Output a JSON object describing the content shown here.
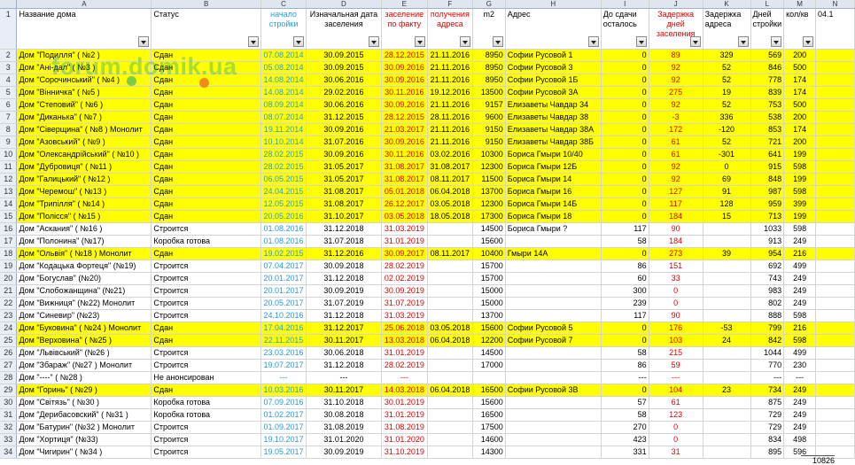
{
  "columns": [
    "A",
    "B",
    "C",
    "D",
    "E",
    "F",
    "G",
    "H",
    "I",
    "J",
    "K",
    "L",
    "M",
    "N"
  ],
  "headers": {
    "name": "Название дома",
    "status": "Статус",
    "start": "начало стройки",
    "orig_date": "Изначальная дата заселения",
    "actual": "заселение по факту",
    "address_received": "получения адреса",
    "m2": "m2",
    "address": "Адрес",
    "left_days": "До сдачи осталось",
    "delay_days": "Задержка дней заселения",
    "address_delay": "Задержка адреса",
    "build_days": "Дней стройки",
    "apartments": "кол/кв",
    "extra": "04.1"
  },
  "rows": [
    {
      "r": "2",
      "hl": true,
      "name": "Дом \"Подилля\" ( №2 )",
      "status": "Сдан",
      "start": "07.08.2014",
      "orig": "30.09.2015",
      "actual": "28.12.2015",
      "addr_date": "21.11.2016",
      "m2": "8950",
      "address": "Софии Русовой 1",
      "left": "0",
      "delay": "89",
      "adelay": "329",
      "days": "569",
      "apts": "200"
    },
    {
      "r": "3",
      "hl": true,
      "name": "Дом \"Ані-дал\" ( №3 )",
      "status": "Сдан",
      "start": "05.08.2014",
      "orig": "30.09.2015",
      "actual": "30.09.2016",
      "addr_date": "21.11.2016",
      "m2": "8950",
      "address": "Софии Русовой 3",
      "left": "0",
      "delay": "92",
      "adelay": "52",
      "days": "846",
      "apts": "500"
    },
    {
      "r": "4",
      "hl": true,
      "name": "Дом \"Сорочинський\" ( №4 )",
      "status": "Сдан",
      "start": "14.08.2014",
      "orig": "30.06.2016",
      "actual": "30.09.2016",
      "addr_date": "21.11.2016",
      "m2": "8950",
      "address": "Софии Русовой 1Б",
      "left": "0",
      "delay": "92",
      "adelay": "52",
      "days": "778",
      "apts": "174"
    },
    {
      "r": "5",
      "hl": true,
      "name": "Дом \"Вінничка\" ( №5 )",
      "status": "Сдан",
      "start": "14.08.2014",
      "orig": "29.02.2016",
      "actual": "30.11.2016",
      "addr_date": "19.12.2016",
      "m2": "13500",
      "address": "Софии Русовой 3А",
      "left": "0",
      "delay": "275",
      "adelay": "19",
      "days": "839",
      "apts": "174"
    },
    {
      "r": "6",
      "hl": true,
      "name": "Дом \"Степовий\" ( №6 )",
      "status": "Сдан",
      "start": "08.09.2014",
      "orig": "30.06.2016",
      "actual": "30.09.2016",
      "addr_date": "21.11.2016",
      "m2": "9157",
      "address": "Елизаветы Чавдар 34",
      "left": "0",
      "delay": "92",
      "adelay": "52",
      "days": "753",
      "apts": "500"
    },
    {
      "r": "7",
      "hl": true,
      "name": "Дом \"Диканька\" ( №7 )",
      "status": "Сдан",
      "start": "08.07.2014",
      "orig": "31.12.2015",
      "actual": "28.12.2015",
      "addr_date": "28.11.2016",
      "m2": "9600",
      "address": "Елизаветы Чавдар 38",
      "left": "0",
      "delay": "-3",
      "adelay": "336",
      "days": "538",
      "apts": "200"
    },
    {
      "r": "8",
      "hl": true,
      "name": "Дом \"Сіверщина\" ( №8 ) Монолит",
      "status": "Сдан",
      "start": "19.11.2014",
      "orig": "30.09.2016",
      "actual": "21.03.2017",
      "addr_date": "21.11.2016",
      "m2": "9150",
      "address": "Елизаветы Чавдар 38А",
      "left": "0",
      "delay": "172",
      "adelay": "-120",
      "days": "853",
      "apts": "174"
    },
    {
      "r": "9",
      "hl": true,
      "name": "Дом \"Азовський\" ( №9 )",
      "status": "Сдан",
      "start": "10.10.2014",
      "orig": "31.07.2016",
      "actual": "30.09.2016",
      "addr_date": "21.11.2016",
      "m2": "9150",
      "address": "Елизаветы Чавдар 38Б",
      "left": "0",
      "delay": "61",
      "adelay": "52",
      "days": "721",
      "apts": "200"
    },
    {
      "r": "10",
      "hl": true,
      "name": "Дом \"Олександрійський\" ( №10 )",
      "status": "Сдан",
      "start": "28.02.2015",
      "orig": "30.09.2016",
      "actual": "30.11.2016",
      "addr_date": "03.02.2016",
      "m2": "10300",
      "address": "Бориса Гмыри 10/40",
      "left": "0",
      "delay": "61",
      "adelay": "-301",
      "days": "641",
      "apts": "199"
    },
    {
      "r": "11",
      "hl": true,
      "name": "Дом \"Дубровиця\" ( №11 )",
      "status": "Сдан",
      "start": "28.02.2015",
      "orig": "31.05.2017",
      "actual": "31.08.2017",
      "addr_date": "31.08.2017",
      "m2": "12300",
      "address": "Бориса Гмыри 12Б",
      "left": "0",
      "delay": "92",
      "adelay": "0",
      "days": "915",
      "apts": "598"
    },
    {
      "r": "12",
      "hl": true,
      "name": "Дом \"Галицький\" ( №12 )",
      "status": "Сдан",
      "start": "06.05.2015",
      "orig": "31.05.2017",
      "actual": "31.08.2017",
      "addr_date": "08.11.2017",
      "m2": "11500",
      "address": "Бориса Гмыри 14",
      "left": "0",
      "delay": "92",
      "adelay": "69",
      "days": "848",
      "apts": "199"
    },
    {
      "r": "13",
      "hl": true,
      "name": "Дом \"Черемош\" ( №13 )",
      "status": "Сдан",
      "start": "24.04.2015",
      "orig": "31.08.2017",
      "actual": "05.01.2018",
      "addr_date": "06.04.2018",
      "m2": "13700",
      "address": "Бориса Гмыри 16",
      "left": "0",
      "delay": "127",
      "adelay": "91",
      "days": "987",
      "apts": "598"
    },
    {
      "r": "14",
      "hl": true,
      "name": "Дом \"Трипілля\" ( №14 )",
      "status": "Сдан",
      "start": "12.05.2015",
      "orig": "31.08.2017",
      "actual": "26.12.2017",
      "addr_date": "03.05.2018",
      "m2": "12300",
      "address": "Бориса Гмыри 14Б",
      "left": "0",
      "delay": "117",
      "adelay": "128",
      "days": "959",
      "apts": "399"
    },
    {
      "r": "15",
      "hl": true,
      "name": "Дом \"Полісся\" ( №15 )",
      "status": "Сдан",
      "start": "20.05.2016",
      "orig": "31.10.2017",
      "actual": "03.05.2018",
      "addr_date": "18.05.2018",
      "m2": "17300",
      "address": "Бориса Гмыри 18",
      "left": "0",
      "delay": "184",
      "adelay": "15",
      "days": "713",
      "apts": "199"
    },
    {
      "r": "16",
      "hl": false,
      "name": "Дом \"Аскания\" ( №16 )",
      "status": "Строится",
      "start": "01.08.2016",
      "orig": "31.12.2018",
      "actual": "31.03.2019",
      "addr_date": "",
      "m2": "14500",
      "address": "Бориса Гмыри ?",
      "left": "117",
      "delay": "90",
      "adelay": "",
      "days": "1033",
      "apts": "598"
    },
    {
      "r": "17",
      "hl": false,
      "name": "Дом \"Полонина\" (№17)",
      "status": "Коробка готова",
      "start": "01.08.2016",
      "orig": "31.07.2018",
      "actual": "31.01.2019",
      "addr_date": "",
      "m2": "15600",
      "address": "",
      "left": "58",
      "delay": "184",
      "adelay": "",
      "days": "913",
      "apts": "249"
    },
    {
      "r": "18",
      "hl": true,
      "name": "Дом \"Ольвія\" ( №18 ) Монолит",
      "status": "Сдан",
      "start": "19.02.2015",
      "orig": "31.12.2016",
      "actual": "30.09.2017",
      "addr_date": "08.11.2017",
      "m2": "10400",
      "address": "Гмыри 14А",
      "left": "0",
      "delay": "273",
      "adelay": "39",
      "days": "954",
      "apts": "216"
    },
    {
      "r": "19",
      "hl": false,
      "name": "Дом \"Кодацька Фортеця\" (№19)",
      "status": "Строится",
      "start": "07.04.2017",
      "orig": "30.09.2018",
      "actual": "28.02.2019",
      "addr_date": "",
      "m2": "15700",
      "address": "",
      "left": "86",
      "delay": "151",
      "adelay": "",
      "days": "692",
      "apts": "499"
    },
    {
      "r": "20",
      "hl": false,
      "name": "Дом \"Богуслав\" (№20)",
      "status": "Строится",
      "start": "20.01.2017",
      "orig": "31.12.2018",
      "actual": "02.02.2019",
      "addr_date": "",
      "m2": "15700",
      "address": "",
      "left": "60",
      "delay": "33",
      "adelay": "",
      "days": "743",
      "apts": "249"
    },
    {
      "r": "21",
      "hl": false,
      "name": "Дом \"Слобожанщина\" (№21)",
      "status": "Строится",
      "start": "20.01.2017",
      "orig": "30.09.2019",
      "actual": "30.09.2019",
      "addr_date": "",
      "m2": "15000",
      "address": "",
      "left": "300",
      "delay": "0",
      "adelay": "",
      "days": "983",
      "apts": "249"
    },
    {
      "r": "22",
      "hl": false,
      "name": "Дом \"Вижниця\" (№22) Монолит",
      "status": "Строится",
      "start": "20.05.2017",
      "orig": "31.07.2019",
      "actual": "31.07.2019",
      "addr_date": "",
      "m2": "15000",
      "address": "",
      "left": "239",
      "delay": "0",
      "adelay": "",
      "days": "802",
      "apts": "249"
    },
    {
      "r": "23",
      "hl": false,
      "name": "Дом \"Синевир\" (№23)",
      "status": "Строится",
      "start": "24.10.2016",
      "orig": "31.12.2018",
      "actual": "31.03.2019",
      "addr_date": "",
      "m2": "13700",
      "address": "",
      "left": "117",
      "delay": "90",
      "adelay": "",
      "days": "888",
      "apts": "598"
    },
    {
      "r": "24",
      "hl": true,
      "name": "Дом \"Буковина\" ( №24 ) Монолит",
      "status": "Сдан",
      "start": "17.04.2016",
      "orig": "31.12.2017",
      "actual": "25.06.2018",
      "addr_date": "03.05.2018",
      "m2": "15600",
      "address": "Софии Русовой 5",
      "left": "0",
      "delay": "176",
      "adelay": "-53",
      "days": "799",
      "apts": "216"
    },
    {
      "r": "25",
      "hl": true,
      "name": "Дом \"Верховина\" ( №25 )",
      "status": "Сдан",
      "start": "22.11.2015",
      "orig": "30.11.2017",
      "actual": "13.03.2018",
      "addr_date": "06.04.2018",
      "m2": "12200",
      "address": "Софии Русовой 7",
      "left": "0",
      "delay": "103",
      "adelay": "24",
      "days": "842",
      "apts": "598"
    },
    {
      "r": "26",
      "hl": false,
      "name": "Дом \"Львівський\" (№26 )",
      "status": "Строится",
      "start": "23.03.2016",
      "orig": "30.06.2018",
      "actual": "31.01.2019",
      "addr_date": "",
      "m2": "14500",
      "address": "",
      "left": "58",
      "delay": "215",
      "adelay": "",
      "days": "1044",
      "apts": "499"
    },
    {
      "r": "27",
      "hl": false,
      "name": "Дом \"Збараж\" (№27 ) Монолит",
      "status": "Строится",
      "start": "19.07.2017",
      "orig": "31.12.2018",
      "actual": "28.02.2019",
      "addr_date": "",
      "m2": "17000",
      "address": "",
      "left": "86",
      "delay": "59",
      "adelay": "",
      "days": "770",
      "apts": "230"
    },
    {
      "r": "28",
      "hl": false,
      "name": "Дом \"----\" ( №28 )",
      "status": "Не анонсирован",
      "start": "---",
      "orig": "---",
      "actual": "---",
      "addr_date": "",
      "m2": "",
      "address": "",
      "left": "---",
      "delay": "---",
      "adelay": "",
      "days": "---",
      "apts": "---"
    },
    {
      "r": "29",
      "hl": true,
      "name": "Дом \"Горинь\" ( №29 )",
      "status": "Сдан",
      "start": "10.03.2016",
      "orig": "30.11.2017",
      "actual": "14.03.2018",
      "addr_date": "06.04.2018",
      "m2": "16500",
      "address": "Софии Русовой 3В",
      "left": "0",
      "delay": "104",
      "adelay": "23",
      "days": "734",
      "apts": "249"
    },
    {
      "r": "30",
      "hl": false,
      "name": "Дом \"Світязь\" ( №30 )",
      "status": "Коробка готова",
      "start": "07.09.2016",
      "orig": "31.10.2018",
      "actual": "30.01.2019",
      "addr_date": "",
      "m2": "15600",
      "address": "",
      "left": "57",
      "delay": "61",
      "adelay": "",
      "days": "875",
      "apts": "249"
    },
    {
      "r": "31",
      "hl": false,
      "name": "Дом \"Дерибасовский\" ( №31 )",
      "status": "Коробка готова",
      "start": "01.02.2017",
      "orig": "30.08.2018",
      "actual": "31.01.2019",
      "addr_date": "",
      "m2": "16500",
      "address": "",
      "left": "58",
      "delay": "123",
      "adelay": "",
      "days": "729",
      "apts": "249"
    },
    {
      "r": "32",
      "hl": false,
      "name": "Дом \"Батурин\" (№32 ) Монолит",
      "status": "Строится",
      "start": "01.09.2017",
      "orig": "31.08.2019",
      "actual": "31.08.2019",
      "addr_date": "",
      "m2": "17500",
      "address": "",
      "left": "270",
      "delay": "0",
      "adelay": "",
      "days": "729",
      "apts": "249"
    },
    {
      "r": "33",
      "hl": false,
      "name": "Дом \"Хортиця\" (№33)",
      "status": "Строится",
      "start": "19.10.2017",
      "orig": "31.01.2020",
      "actual": "31.01.2020",
      "addr_date": "",
      "m2": "14600",
      "address": "",
      "left": "423",
      "delay": "0",
      "adelay": "",
      "days": "834",
      "apts": "498"
    },
    {
      "r": "34",
      "hl": false,
      "name": "Дом \"Чигирин\" ( №34 )",
      "status": "Строится",
      "start": "19.05.2017",
      "orig": "30.09.2019",
      "actual": "31.10.2019",
      "addr_date": "",
      "m2": "14300",
      "address": "",
      "left": "331",
      "delay": "31",
      "adelay": "",
      "days": "895",
      "apts": "596"
    }
  ],
  "total_apartments": "10826",
  "watermark": "forum.domik.ua",
  "colors": {
    "highlight": "#ffff00",
    "red": "#e00000",
    "blue": "#2a9ad8"
  }
}
